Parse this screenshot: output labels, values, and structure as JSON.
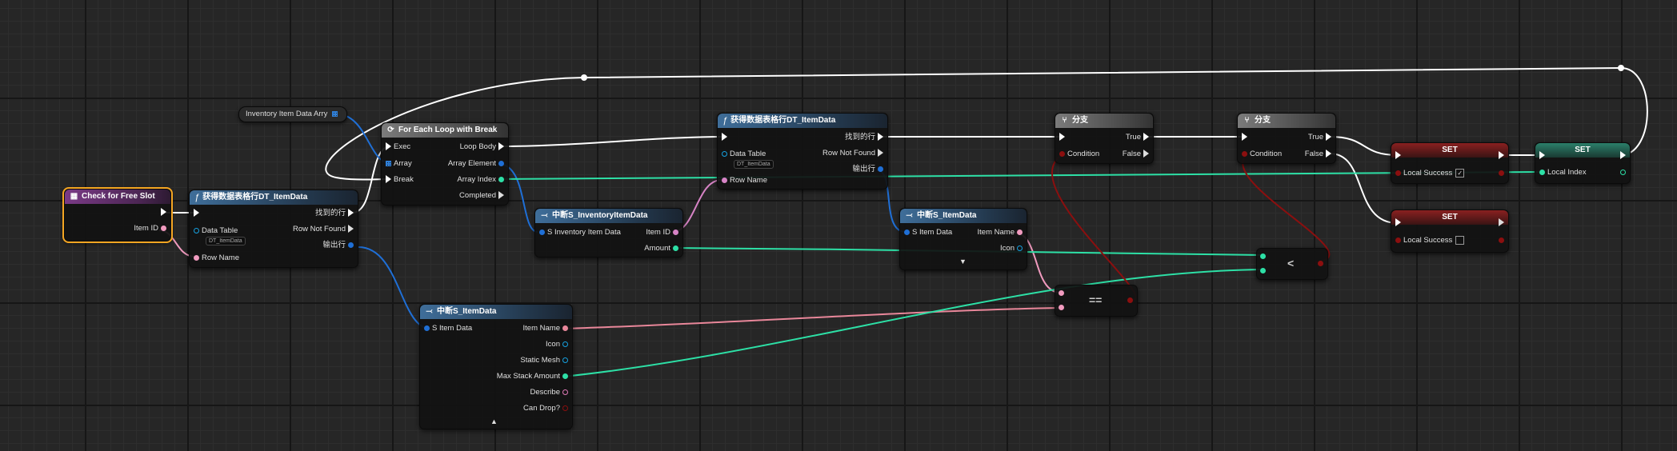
{
  "colors": {
    "exec": "#ffffff",
    "name": "#f19bbf",
    "struct": "#1f6fd6",
    "int": "#2de0a6",
    "bool": "#8b0f0f",
    "object": "#16a1e0"
  },
  "var_get": {
    "label": "Inventory Item Data Arry"
  },
  "event": {
    "title": "Check for Free Slot",
    "item_id": "Item ID"
  },
  "get_row1": {
    "title": "获得数据表格行DT_ItemData",
    "found": "找到的行",
    "data_table": "Data Table",
    "dt_value": "DT_ItemData",
    "row_not_found": "Row Not Found",
    "out_row": "输出行",
    "row_name": "Row Name"
  },
  "foreach": {
    "title": "For Each Loop with Break",
    "exec": "Exec",
    "loop_body": "Loop Body",
    "array": "Array",
    "array_element": "Array Element",
    "break": "Break",
    "array_index": "Array Index",
    "completed": "Completed"
  },
  "break_inv": {
    "title": "中断S_InventoryItemData",
    "in": "S Inventory Item Data",
    "item_id": "Item ID",
    "amount": "Amount"
  },
  "get_row2": {
    "title": "获得数据表格行DT_ItemData",
    "found": "找到的行",
    "data_table": "Data Table",
    "dt_value": "DT_ItemData",
    "row_not_found": "Row Not Found",
    "out_row": "输出行",
    "row_name": "Row Name"
  },
  "break_item1": {
    "title": "中断S_ItemData",
    "in": "S Item Data",
    "item_name": "Item Name",
    "icon": "Icon"
  },
  "break_item2": {
    "title": "中断S_ItemData",
    "in": "S Item Data",
    "item_name": "Item Name",
    "icon": "Icon",
    "static_mesh": "Static Mesh",
    "max_stack": "Max Stack Amount",
    "describe": "Describe",
    "can_drop": "Can Drop?"
  },
  "branch1": {
    "title": "分支",
    "condition": "Condition",
    "true": "True",
    "false": "False"
  },
  "branch2": {
    "title": "分支",
    "condition": "Condition",
    "true": "True",
    "false": "False"
  },
  "set1": {
    "title": "SET",
    "var": "Local Success",
    "checked": true
  },
  "set2": {
    "title": "SET",
    "var": "Local Index"
  },
  "set3": {
    "title": "SET",
    "var": "Local Success",
    "checked": false
  },
  "ops": {
    "equals": "==",
    "less": "<"
  }
}
